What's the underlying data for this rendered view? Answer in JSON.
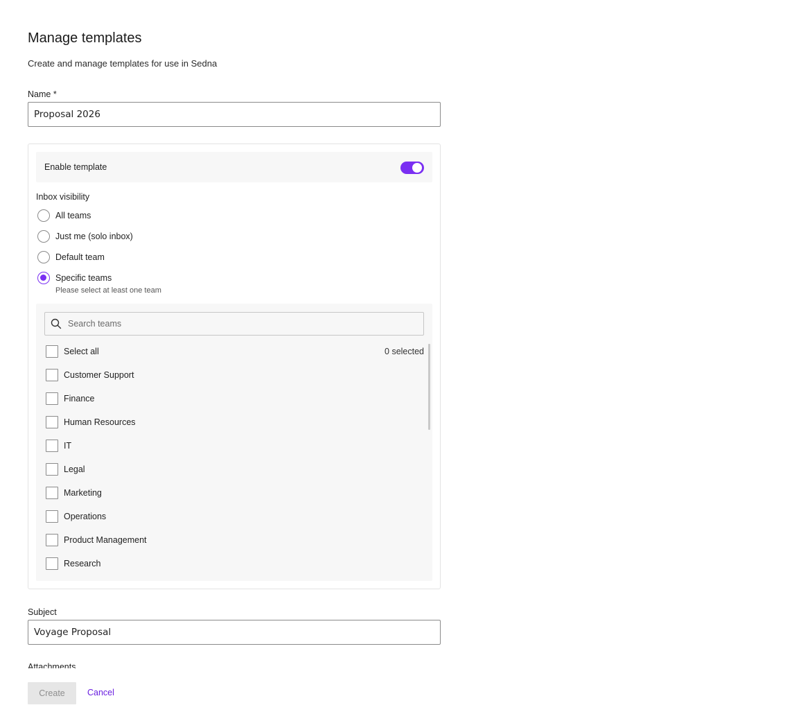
{
  "header": {
    "title": "Manage templates",
    "subtitle": "Create and manage templates for use in Sedna"
  },
  "name_field": {
    "label": "Name *",
    "value": "Proposal 2026"
  },
  "enable": {
    "label": "Enable template",
    "enabled": true
  },
  "visibility": {
    "label": "Inbox visibility",
    "options": [
      {
        "label": "All teams",
        "checked": false
      },
      {
        "label": "Just me (solo inbox)",
        "checked": false
      },
      {
        "label": "Default team",
        "checked": false
      },
      {
        "label": "Specific teams",
        "checked": true
      }
    ],
    "hint": "Please select at least one team"
  },
  "teams": {
    "search_placeholder": "Search teams",
    "select_all": "Select all",
    "selected_count": "0 selected",
    "items": [
      {
        "label": "Customer Support",
        "checked": false
      },
      {
        "label": "Finance",
        "checked": false
      },
      {
        "label": "Human Resources",
        "checked": false
      },
      {
        "label": "IT",
        "checked": false
      },
      {
        "label": "Legal",
        "checked": false
      },
      {
        "label": "Marketing",
        "checked": false
      },
      {
        "label": "Operations",
        "checked": false
      },
      {
        "label": "Product Management",
        "checked": false
      },
      {
        "label": "Research",
        "checked": false
      }
    ]
  },
  "subject_field": {
    "label": "Subject",
    "value": "Voyage Proposal"
  },
  "attachments": {
    "label": "Attachments"
  },
  "actions": {
    "create_label": "Create",
    "cancel_label": "Cancel"
  },
  "colors": {
    "accent": "#7a2ff2",
    "link": "#6a1fe0",
    "disabled_bg": "#e6e6e6"
  }
}
